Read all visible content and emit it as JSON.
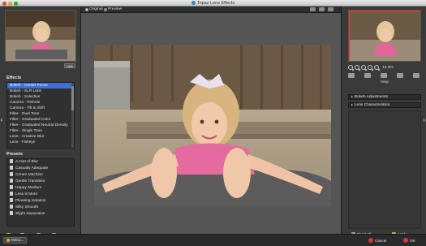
{
  "window": {
    "title": "Topaz Lens Effects"
  },
  "left_panel": {
    "hide_label": "Hide",
    "effects_label": "Effects",
    "effects": [
      "Bokeh - Center Focus",
      "Bokeh - SLR Lens",
      "Bokeh - Selective",
      "Camera - Pinhole",
      "Camera - Tilt & Shift",
      "Filter - Dual Tone",
      "Filter - Graduated Color",
      "Filter - Graduated Neutral Density",
      "Filter - Single Tone",
      "Lens - Creative Blur",
      "Lens - Fisheye"
    ],
    "selected_effect_index": 0,
    "presets_label": "Presets",
    "presets": [
      "A Hint of Blur",
      "Casually Adequate",
      "Cream Machine",
      "Gentle Transition",
      "Happy Medium",
      "Less is More",
      "Pleasing Isolation",
      "Silky Smooth",
      "Slight Separation"
    ],
    "preset_tools": [
      "Save",
      "Delete",
      "Import",
      "Export"
    ]
  },
  "center": {
    "tab_original": "Original",
    "tab_preview": "Preview",
    "active_tab": "Preview"
  },
  "right_panel": {
    "zoom_value": "14.3%",
    "snap_label": "Snap",
    "sections": [
      "Bokeh Adjustments",
      "Lens Characteristics"
    ],
    "reset_all_label": "Reset All",
    "apply_label": "Apply"
  },
  "bottom": {
    "menu_label": "Menu...",
    "cancel_label": "Cancel",
    "ok_label": "OK"
  },
  "colors": {
    "selection": "#3f6fd0",
    "cancel_icon": "#d23a3a",
    "nav_frame": "#ff3030"
  }
}
